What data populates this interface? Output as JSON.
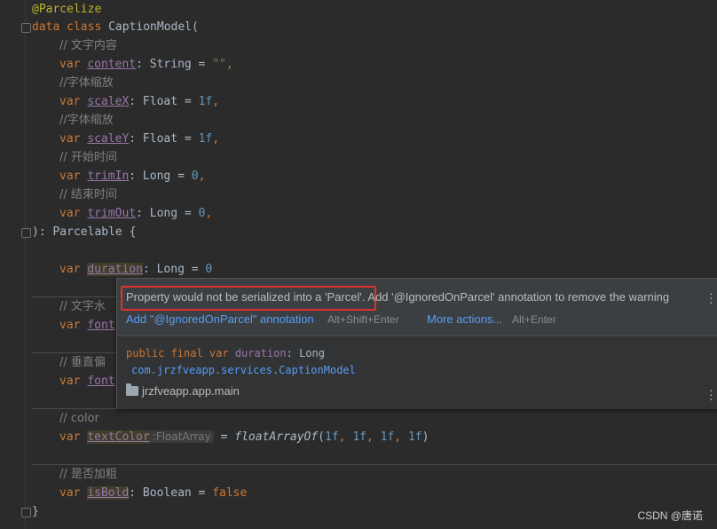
{
  "code": {
    "l1": {
      "ann": "@Parcelize"
    },
    "l2": {
      "kw": "data class ",
      "name": "CaptionModel("
    },
    "l3": {
      "comment": "// 文字内容"
    },
    "l4": {
      "kw": "var ",
      "prop": "content",
      "type": ": String = ",
      "val": "\"\"",
      "end": ","
    },
    "l5": {
      "comment": "//字体缩放"
    },
    "l6": {
      "kw": "var ",
      "prop": "scaleX",
      "type": ": Float = ",
      "val": "1f",
      "end": ","
    },
    "l7": {
      "comment": "//字体缩放"
    },
    "l8": {
      "kw": "var ",
      "prop": "scaleY",
      "type": ": Float = ",
      "val": "1f",
      "end": ","
    },
    "l9": {
      "comment": "// 开始时间"
    },
    "l10": {
      "kw": "var ",
      "prop": "trimIn",
      "type": ": Long = ",
      "val": "0",
      "end": ","
    },
    "l11": {
      "comment": "// 结束时间"
    },
    "l12": {
      "kw": "var ",
      "prop": "trimOut",
      "type": ": Long = ",
      "val": "0",
      "end": ","
    },
    "l13": {
      "text": "): Parcelable {"
    },
    "l14": {
      "kw": "var ",
      "prop": "duration",
      "type": ": Long = ",
      "val": "0"
    },
    "l15": {
      "comment": "// 文字水"
    },
    "l16": {
      "kw": "var ",
      "prop": "font"
    },
    "l17": {
      "comment": "// 垂直偏"
    },
    "l18": {
      "kw": "var ",
      "prop": "font"
    },
    "l19": {
      "comment": "// color"
    },
    "l20": {
      "kw": "var ",
      "prop": "textColor",
      "hint": ":FloatArray",
      "eq": " = ",
      "fn": "floatArrayOf",
      "args_open": "(",
      "a1": "1f",
      "a2": "1f",
      "a3": "1f",
      "a4": "1f",
      "args_close": ")",
      "comma": ", "
    },
    "l21": {
      "comment": "// 是否加粗"
    },
    "l22": {
      "kw": "var ",
      "prop": "isBold",
      "type": ": Boolean = ",
      "val": "false"
    },
    "l23": {
      "text": "}"
    }
  },
  "popup": {
    "message_part1": "Property would not be serialized into a 'Parcel'.",
    "message_part2": " Add '@IgnoredOnParcel' annotation to remove the warning",
    "action1": "Add \"@IgnoredOnParcel\" annotation",
    "action1_shortcut": "Alt+Shift+Enter",
    "action2": "More actions...",
    "action2_shortcut": "Alt+Enter",
    "decl_mods": "public final var ",
    "decl_name": "duration",
    "decl_type": ": Long",
    "package": "com.jrzfveapp.services.CaptionModel",
    "module": "jrzfveapp.app.main"
  },
  "watermark": "CSDN @唐诺",
  "colors": {
    "keyword": "#cc7832",
    "number": "#6897bb",
    "string": "#6a8759",
    "property": "#9876aa",
    "annotation": "#bbb529",
    "highlight_box": "#e0322e",
    "link": "#589df6"
  }
}
